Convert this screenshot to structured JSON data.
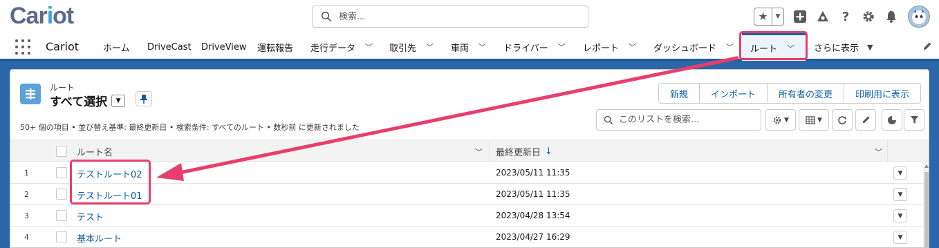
{
  "header": {
    "logo_main": "Car",
    "logo_dot": "i",
    "logo_tail": "ot",
    "search_placeholder": "検索...",
    "icons": [
      "favorites-star-icon",
      "add-icon",
      "trailhead-icon",
      "help-icon",
      "setup-gear-icon",
      "notifications-bell-icon",
      "user-avatar"
    ]
  },
  "nav": {
    "app_name": "Cariot",
    "items": [
      {
        "label": "ホーム"
      },
      {
        "label": "DriveCast"
      },
      {
        "label": "DriveView"
      },
      {
        "label": "運転報告"
      },
      {
        "label": "走行データ"
      },
      {
        "label": "取引先"
      },
      {
        "label": "車両"
      },
      {
        "label": "ドライバー"
      },
      {
        "label": "レポート"
      },
      {
        "label": "ダッシュボード"
      },
      {
        "label": "ルート"
      },
      {
        "label": "さらに表示"
      }
    ],
    "active": "ルート"
  },
  "list": {
    "object_label": "ルート",
    "view_name": "すべて選択",
    "buttons": {
      "new": "新規",
      "import": "インポート",
      "change_owner": "所有者の変更",
      "print": "印刷用に表示"
    },
    "summary": "50+ 個の項目 • 並び替え基準: 最終更新日 • 検索条件: すべてのルート • 数秒前 に更新されました",
    "search_placeholder": "このリストを検索...",
    "columns": {
      "name": "ルート名",
      "last_modified": "最終更新日",
      "sort_indicator": "↓"
    },
    "rows": [
      {
        "num": "1",
        "name": "テストルート02",
        "date": "2023/05/11 11:35"
      },
      {
        "num": "2",
        "name": "テストルート01",
        "date": "2023/05/11 11:35"
      },
      {
        "num": "3",
        "name": "テスト",
        "date": "2023/04/28 13:54"
      },
      {
        "num": "4",
        "name": "基本ルート",
        "date": "2023/04/27 16:29"
      }
    ]
  },
  "colors": {
    "accent_blue": "#0b5cab",
    "nav_underline": "#1b5f9f",
    "annotation_pink": "#e83e6c"
  }
}
